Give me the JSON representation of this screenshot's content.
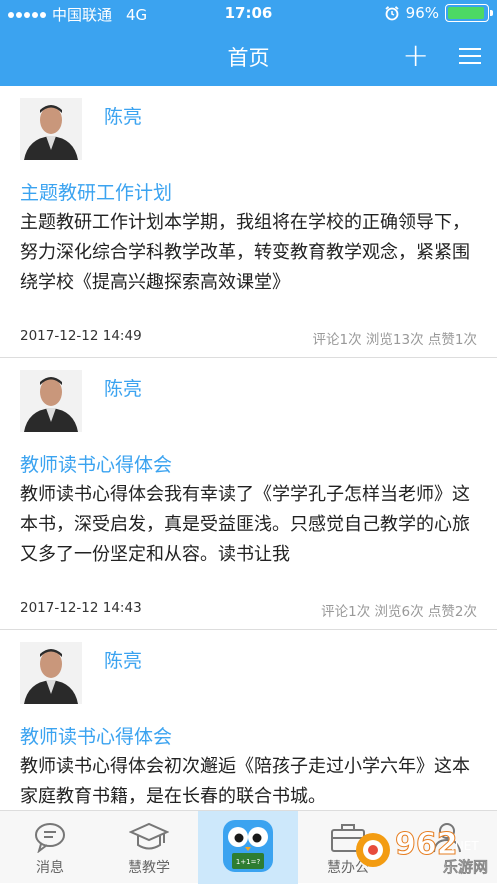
{
  "status_bar": {
    "carrier": "中国联通",
    "network": "4G",
    "time": "17:06",
    "battery": "96%",
    "battery_level": 0.96
  },
  "nav": {
    "title": "首页",
    "add_icon": "plus-icon",
    "menu_icon": "menu-icon"
  },
  "posts": [
    {
      "author": "陈亮",
      "title": "主题教研工作计划",
      "body": "主题教研工作计划本学期，我组将在学校的正确领导下，努力深化综合学科教学改革，转变教育教学观念，紧紧围绕学校《提高兴趣探索高效课堂》",
      "time": "2017-12-12 14:49",
      "stats": "评论1次 浏览13次 点赞1次"
    },
    {
      "author": "陈亮",
      "title": "教师读书心得体会",
      "body": "教师读书心得体会我有幸读了《学学孔子怎样当老师》这本书，深受启发，真是受益匪浅。只感觉自己教学的心旅又多了一份坚定和从容。读书让我",
      "time": "2017-12-12 14:43",
      "stats": "评论1次 浏览6次 点赞2次"
    },
    {
      "author": "陈亮",
      "title": "教师读书心得体会",
      "body": "教师读书心得体会初次邂逅《陪孩子走过小学六年》这本家庭教育书籍，是在长春的联合书城。",
      "time": "",
      "stats": ""
    }
  ],
  "tabs": [
    {
      "label": "消息",
      "icon": "chat-bubble-icon"
    },
    {
      "label": "慧教学",
      "icon": "graduation-cap-icon"
    },
    {
      "label": "",
      "icon": "owl-mascot-icon"
    },
    {
      "label": "慧办公",
      "icon": "briefcase-icon"
    },
    {
      "label": "",
      "icon": "person-icon"
    }
  ],
  "watermark": {
    "text": "962",
    "subtext": "乐游网",
    "domain": ".NET"
  },
  "colors": {
    "accent": "#3ba3f0",
    "center_tab_bg": "#cde8fb",
    "battery_fill": "#4cd964"
  }
}
